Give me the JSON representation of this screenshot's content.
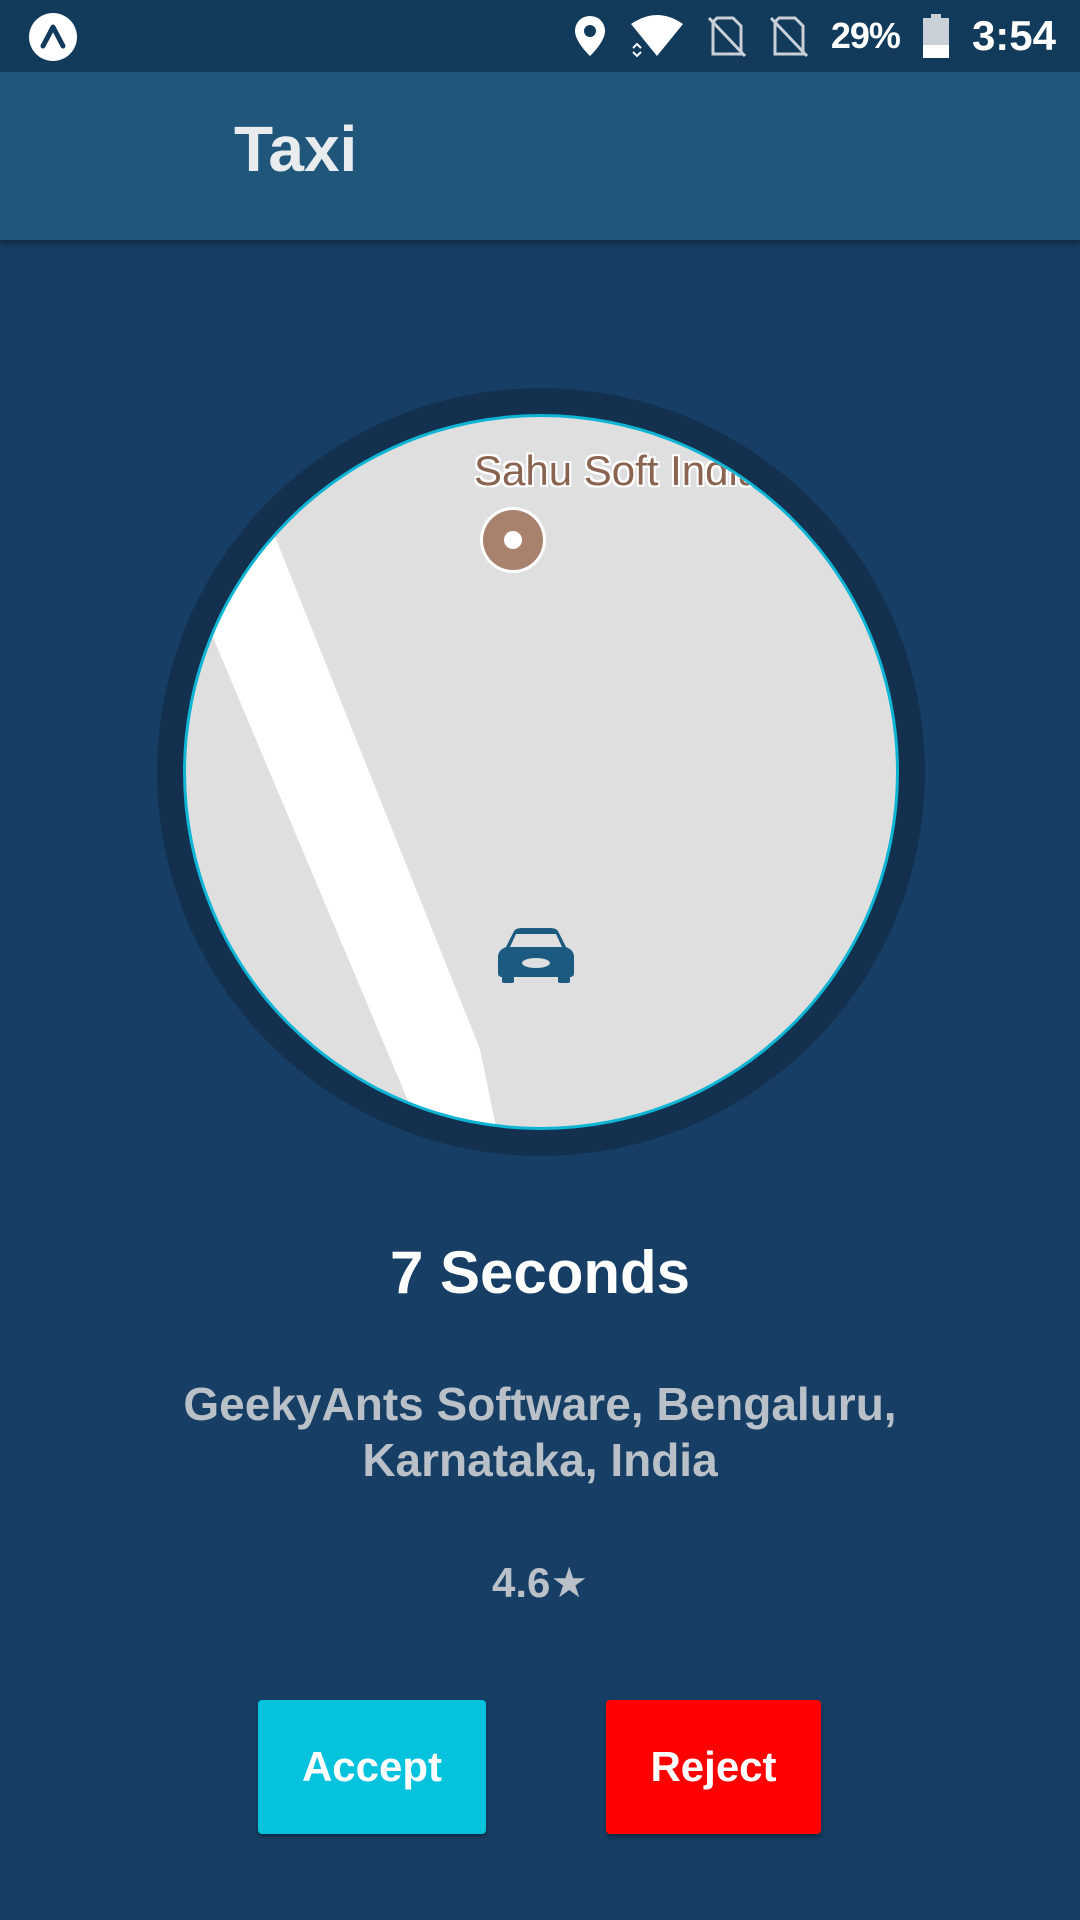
{
  "status_bar": {
    "battery": "29%",
    "clock": "3:54",
    "icons": [
      "expo-icon",
      "location-icon",
      "wifi-icon",
      "no-sim-icon",
      "no-sim-icon",
      "battery-icon"
    ]
  },
  "app_bar": {
    "title": "Taxi"
  },
  "map": {
    "place_label": "Sahu Soft India",
    "icons": [
      "place-pin-icon",
      "car-icon"
    ],
    "colors": {
      "ring": "#13314f",
      "border": "#0fb5d4",
      "land": "#dfdfdf",
      "road": "#ffffff"
    }
  },
  "ride_request": {
    "timer": "7 Seconds",
    "address_line1": "GeekyAnts Software, Bengaluru,",
    "address_line2": "Karnataka, India",
    "rating": "4.6★"
  },
  "actions": {
    "accept_label": "Accept",
    "reject_label": "Reject"
  },
  "colors": {
    "background": "#173f65",
    "status_bar": "#123a5b",
    "app_bar": "#1f5679",
    "accept": "#05c2dd",
    "reject": "#ff0000"
  }
}
